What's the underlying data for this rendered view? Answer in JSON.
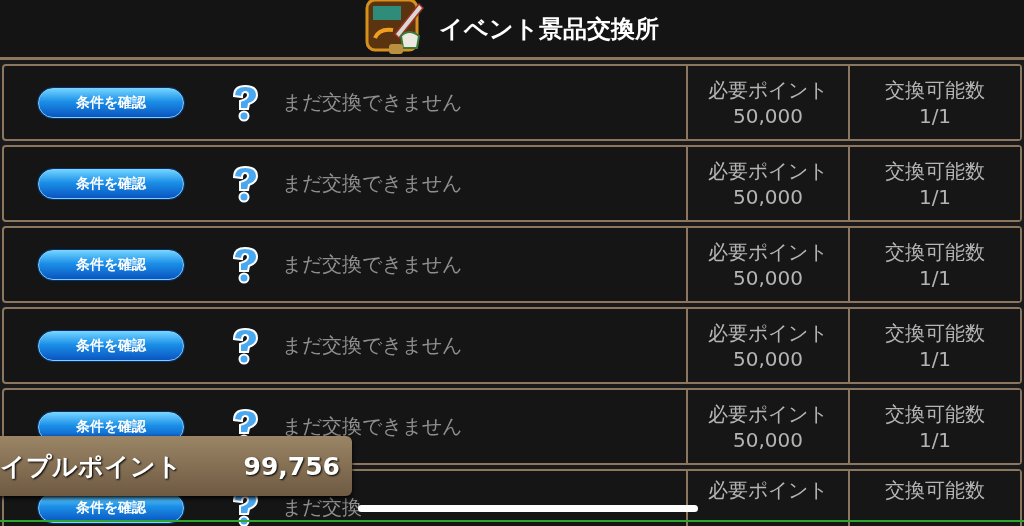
{
  "header": {
    "title": "イベント景品交換所"
  },
  "rewards": [
    {
      "button": "条件を確認",
      "status": "まだ交換できません",
      "points_label": "必要ポイント",
      "points": "50,000",
      "count_label": "交換可能数",
      "count": "1/1"
    },
    {
      "button": "条件を確認",
      "status": "まだ交換できません",
      "points_label": "必要ポイント",
      "points": "50,000",
      "count_label": "交換可能数",
      "count": "1/1"
    },
    {
      "button": "条件を確認",
      "status": "まだ交換できません",
      "points_label": "必要ポイント",
      "points": "50,000",
      "count_label": "交換可能数",
      "count": "1/1"
    },
    {
      "button": "条件を確認",
      "status": "まだ交換できません",
      "points_label": "必要ポイント",
      "points": "50,000",
      "count_label": "交換可能数",
      "count": "1/1"
    },
    {
      "button": "条件を確認",
      "status": "まだ交換できません",
      "points_label": "必要ポイント",
      "points": "50,000",
      "count_label": "交換可能数",
      "count": "1/1"
    },
    {
      "button": "条件を確認",
      "status": "まだ交換",
      "points_label": "必要ポイント",
      "count_label": "交換可能数"
    }
  ],
  "points_panel": {
    "label": "イプルポイント",
    "value": "99,756"
  }
}
